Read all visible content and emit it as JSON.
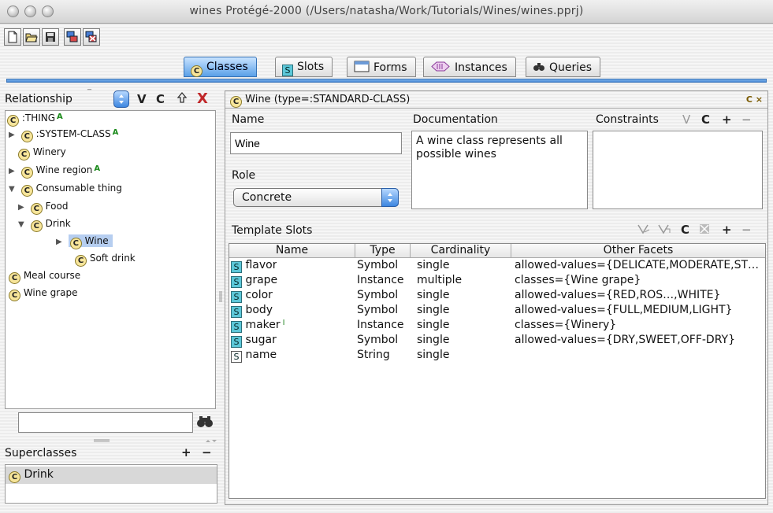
{
  "window": {
    "title": "wines  Protégé-2000   (/Users/natasha/Work/Tutorials/Wines/wines.pprj)"
  },
  "toolbar": {
    "buttons": [
      "new-project-icon",
      "open-project-icon",
      "save-project-icon",
      "cascade-windows-icon",
      "close-windows-icon"
    ]
  },
  "tabs": [
    {
      "label": "Classes",
      "icon": "classes-tab-icon",
      "active": true
    },
    {
      "label": "Slots",
      "icon": "slots-tab-icon",
      "active": false
    },
    {
      "label": "Forms",
      "icon": "forms-tab-icon",
      "active": false
    },
    {
      "label": "Instances",
      "icon": "instances-tab-icon",
      "active": false
    },
    {
      "label": "Queries",
      "icon": "queries-tab-icon",
      "active": false
    }
  ],
  "left": {
    "relationship_label": "Relationship",
    "actions": [
      "V",
      "C",
      "X"
    ],
    "tree": [
      {
        "label": ":THING",
        "badge": "A",
        "depth": 0,
        "expander": "none"
      },
      {
        "label": ":SYSTEM-CLASS",
        "badge": "A",
        "depth": 1,
        "expander": "collapsed"
      },
      {
        "label": "Winery",
        "badge": "",
        "depth": 1,
        "expander": "none"
      },
      {
        "label": "Wine region",
        "badge": "A",
        "depth": 1,
        "expander": "collapsed"
      },
      {
        "label": "Consumable thing",
        "badge": "",
        "depth": 1,
        "expander": "expanded"
      },
      {
        "label": "Food",
        "badge": "",
        "depth": 2,
        "expander": "collapsed"
      },
      {
        "label": "Drink",
        "badge": "",
        "depth": 2,
        "expander": "expanded"
      },
      {
        "label": "Wine",
        "badge": "",
        "depth": 3,
        "expander": "collapsed",
        "selected": true
      },
      {
        "label": "Soft drink",
        "badge": "",
        "depth": 3,
        "expander": "none"
      },
      {
        "label": "Meal course",
        "badge": "",
        "depth": 1,
        "expander": "none"
      },
      {
        "label": "Wine grape",
        "badge": "",
        "depth": 1,
        "expander": "none"
      }
    ],
    "search_value": "",
    "superclasses_label": "Superclasses",
    "superclasses_actions": [
      "+",
      "−"
    ],
    "superclasses": [
      "Drink"
    ]
  },
  "right": {
    "header": "Wine    (type=:STANDARD-CLASS)",
    "corner": "C ×",
    "name_label": "Name",
    "name_value": "Wine",
    "doc_label": "Documentation",
    "doc_value": "A wine class represents all possible wines",
    "constraints_label": "Constraints",
    "constraints_actions": [
      "V",
      "C",
      "+",
      "−"
    ],
    "role_label": "Role",
    "role_value": "Concrete",
    "template_label": "Template Slots",
    "template_actions": [
      "C",
      "+",
      "−"
    ],
    "columns": [
      "Name",
      "Type",
      "Cardinality",
      "Other Facets"
    ],
    "rows": [
      {
        "name": "flavor",
        "type": "Symbol",
        "card": "single",
        "facets": "allowed-values={DELICATE,MODERATE,ST…",
        "icon": "slot"
      },
      {
        "name": "grape",
        "type": "Instance",
        "card": "multiple",
        "facets": "classes={Wine grape}",
        "icon": "slot"
      },
      {
        "name": "color",
        "type": "Symbol",
        "card": "single",
        "facets": "allowed-values={RED,ROS…,WHITE}",
        "icon": "slot"
      },
      {
        "name": "body",
        "type": "Symbol",
        "card": "single",
        "facets": "allowed-values={FULL,MEDIUM,LIGHT}",
        "icon": "slot"
      },
      {
        "name": "maker",
        "type": "Instance",
        "card": "single",
        "facets": "classes={Winery}",
        "icon": "slot"
      },
      {
        "name": "sugar",
        "type": "Symbol",
        "card": "single",
        "facets": "allowed-values={DRY,SWEET,OFF-DRY}",
        "icon": "slot"
      },
      {
        "name": "name",
        "type": "String",
        "card": "single",
        "facets": "",
        "icon": "slot-inherited"
      }
    ]
  }
}
